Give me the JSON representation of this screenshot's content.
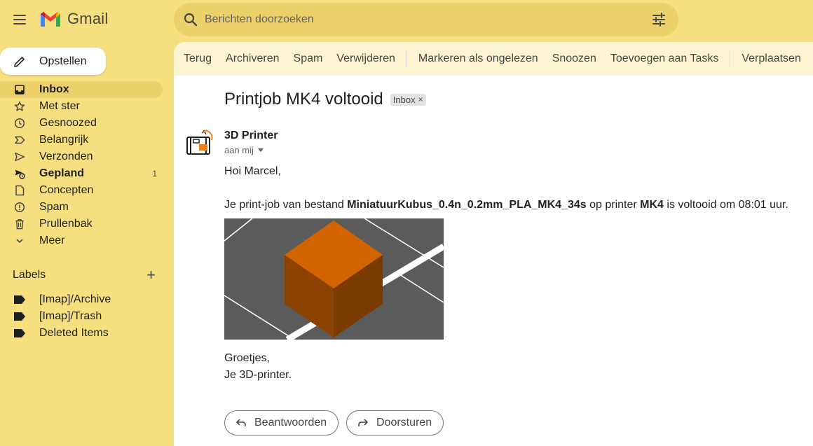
{
  "app": {
    "name": "Gmail"
  },
  "search": {
    "placeholder": "Berichten doorzoeken"
  },
  "compose": {
    "label": "Opstellen"
  },
  "nav": [
    {
      "label": "Inbox",
      "icon": "inbox-icon",
      "active": true
    },
    {
      "label": "Met ster",
      "icon": "star-icon"
    },
    {
      "label": "Gesnoozed",
      "icon": "clock-icon"
    },
    {
      "label": "Belangrijk",
      "icon": "important-icon"
    },
    {
      "label": "Verzonden",
      "icon": "send-icon"
    },
    {
      "label": "Gepland",
      "icon": "scheduled-icon",
      "count": "1",
      "bold": true
    },
    {
      "label": "Concepten",
      "icon": "draft-icon"
    },
    {
      "label": "Spam",
      "icon": "spam-icon"
    },
    {
      "label": "Prullenbak",
      "icon": "trash-icon"
    },
    {
      "label": "Meer",
      "icon": "chevron-down-icon"
    }
  ],
  "labels": {
    "title": "Labels",
    "items": [
      "[Imap]/Archive",
      "[Imap]/Trash",
      "Deleted Items"
    ]
  },
  "toolbar": {
    "back": "Terug",
    "archive": "Archiveren",
    "spam": "Spam",
    "delete": "Verwijderen",
    "mark_unread": "Markeren als ongelezen",
    "snooze": "Snoozen",
    "add_tasks": "Toevoegen aan Tasks",
    "move": "Verplaatsen"
  },
  "email": {
    "subject": "Printjob MK4 voltooid",
    "label_badge": "Inbox",
    "label_badge_close": "×",
    "sender": "3D Printer",
    "to": "aan mij",
    "greeting": "Hoi Marcel,",
    "line_prefix": "Je print-job van bestand ",
    "file_name": "MiniatuurKubus_0.4n_0.2mm_PLA_MK4_34s",
    "line_middle": " op printer ",
    "printer": "MK4",
    "line_suffix": " is voltooid om 08:01 uur.",
    "closing": "Groetjes,",
    "signature": "Je 3D-printer."
  },
  "actions": {
    "reply": "Beantwoorden",
    "forward": "Doorsturen"
  },
  "colors": {
    "background": "#f6df7e",
    "search_bg": "#ecd16a",
    "cube": "#d26400"
  }
}
